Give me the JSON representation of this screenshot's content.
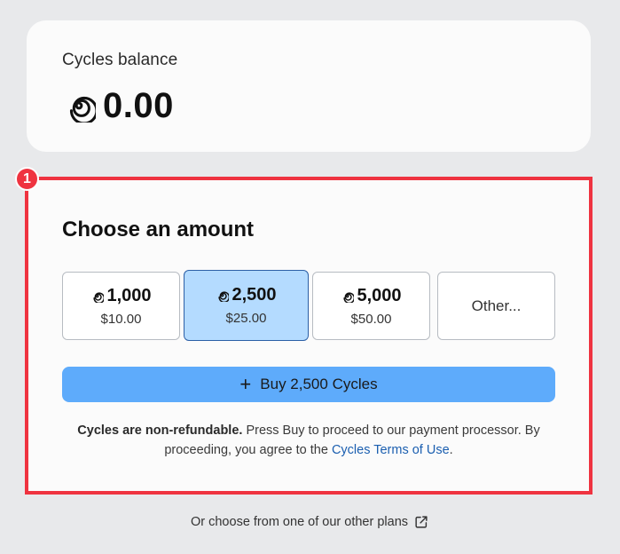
{
  "balance": {
    "label": "Cycles balance",
    "value": "0.00"
  },
  "step_badge": "1",
  "amount": {
    "title": "Choose an amount",
    "options": [
      {
        "cycles": "1,000",
        "price": "$10.00",
        "selected": false
      },
      {
        "cycles": "2,500",
        "price": "$25.00",
        "selected": true
      },
      {
        "cycles": "5,000",
        "price": "$50.00",
        "selected": false
      }
    ],
    "other_label": "Other...",
    "buy_label": "Buy 2,500 Cycles"
  },
  "disclaimer": {
    "bold": "Cycles are non-refundable.",
    "text": " Press Buy to proceed to our payment processor. By proceeding, you agree to the ",
    "link": "Cycles Terms of Use",
    "end": "."
  },
  "other_plans_label": "Or choose from one of our other plans",
  "colors": {
    "highlight": "#ef3340",
    "selected_bg": "#b4dbff",
    "buy_button": "#5eabfb",
    "link": "#1b5fb0"
  },
  "icons": [
    "spiral-icon",
    "plus-icon",
    "external-link-icon"
  ]
}
